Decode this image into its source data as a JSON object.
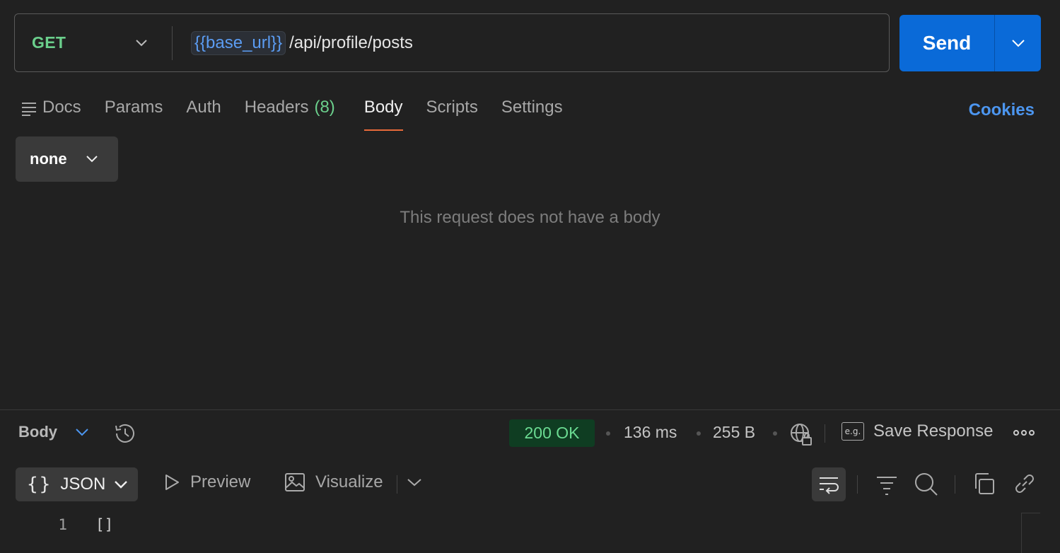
{
  "request": {
    "method": "GET",
    "url_variable": "{{base_url}}",
    "url_path": "/api/profile/posts",
    "send_label": "Send"
  },
  "tabs": [
    {
      "label": "Docs"
    },
    {
      "label": "Params"
    },
    {
      "label": "Auth"
    },
    {
      "label": "Headers",
      "count": "(8)"
    },
    {
      "label": "Body",
      "active": true
    },
    {
      "label": "Scripts"
    },
    {
      "label": "Settings"
    }
  ],
  "cookies_label": "Cookies",
  "body_type": "none",
  "empty_message": "This request does not have a body",
  "response": {
    "section_label": "Body",
    "status": "200 OK",
    "time": "136 ms",
    "size": "255 B",
    "save_label": "Save Response",
    "save_icon_text": "e.g.",
    "format": {
      "braces": "{}",
      "label": "JSON"
    },
    "views": [
      {
        "label": "Preview"
      },
      {
        "label": "Visualize"
      }
    ],
    "lines": [
      {
        "num": "1",
        "text": "[]"
      }
    ]
  },
  "colors": {
    "accent_blue": "#0a6ad8",
    "method_green": "#6bcf8c",
    "status_bg": "#0f3d22",
    "active_tab_underline": "#e86a3a",
    "link_blue": "#4c96f0"
  },
  "icons": [
    "chevron-down-icon",
    "docs-lines-icon",
    "history-icon",
    "globe-lock-icon",
    "save-response-icon",
    "more-icon",
    "play-icon",
    "image-icon",
    "wrap-lines-icon",
    "filter-icon",
    "search-icon",
    "copy-icon",
    "link-icon"
  ]
}
